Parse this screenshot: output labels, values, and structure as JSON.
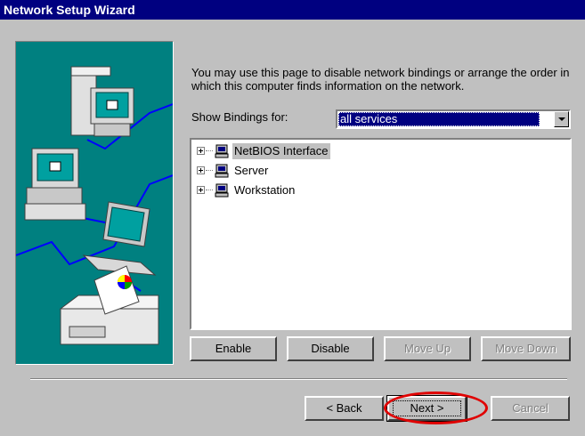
{
  "window": {
    "title": "Network Setup Wizard"
  },
  "description": "You may use this page to disable network bindings or arrange the order in which this computer finds information on the network.",
  "bindings": {
    "label": "Show Bindings for:",
    "selected": "all services"
  },
  "tree": {
    "items": [
      {
        "label": "NetBIOS Interface",
        "icon": "computer-icon"
      },
      {
        "label": "Server",
        "icon": "computer-icon"
      },
      {
        "label": "Workstation",
        "icon": "computer-icon"
      }
    ]
  },
  "actions": {
    "enable": "Enable",
    "disable": "Disable",
    "move_up": "Move Up",
    "move_down": "Move Down"
  },
  "nav": {
    "back": "< Back",
    "next": "Next >",
    "cancel": "Cancel"
  },
  "colors": {
    "titlebar": "#000080",
    "sidebar": "#008080",
    "highlight": "#e00000"
  }
}
